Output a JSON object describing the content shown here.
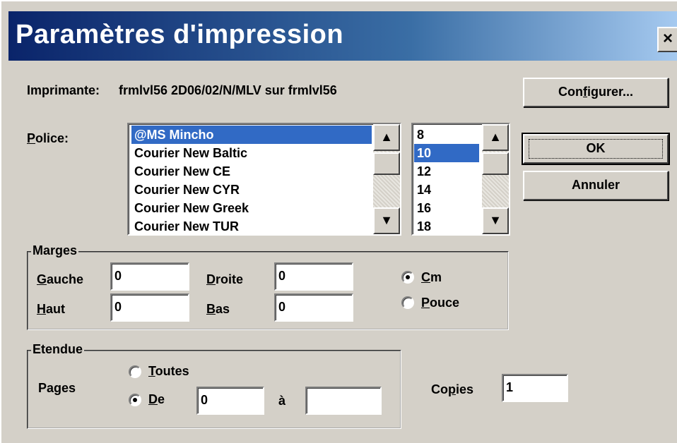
{
  "dialog": {
    "title": "Paramètres d'impression",
    "close_glyph": "×"
  },
  "printer": {
    "label": "Imprimante:",
    "value": "frmlvl56 2D06/02/N/MLV sur frmlvl56"
  },
  "buttons": {
    "configure": {
      "pre": "Con",
      "u": "f",
      "post": "igurer..."
    },
    "ok": "OK",
    "cancel": "Annuler"
  },
  "font": {
    "label_u": "P",
    "label_rest": "olice:",
    "items": [
      "@MS Mincho",
      "Courier New Baltic",
      "Courier New CE",
      "Courier New CYR",
      "Courier New Greek",
      "Courier New TUR"
    ],
    "selected": "@MS Mincho"
  },
  "size": {
    "items": [
      "8",
      "10",
      "12",
      "14",
      "16",
      "18"
    ],
    "selected": "10"
  },
  "scroll_icons": {
    "up": "scroll-up-arrow-icon",
    "down": "scroll-down-arrow-icon"
  },
  "margins": {
    "group_label": "Marges",
    "left": {
      "u": "G",
      "rest": "auche",
      "value": "0"
    },
    "right": {
      "u": "D",
      "rest": "roite",
      "value": "0"
    },
    "top": {
      "u": "H",
      "rest": "aut",
      "value": "0"
    },
    "bottom": {
      "u": "B",
      "rest": "as",
      "value": "0"
    },
    "unit_cm": {
      "u": "C",
      "rest": "m",
      "checked": true
    },
    "unit_inch": {
      "u": "P",
      "rest": "ouce",
      "checked": false
    }
  },
  "range": {
    "group_label": "Etendue",
    "pages_label": "Pages",
    "all": {
      "u": "T",
      "rest": "outes",
      "checked": false
    },
    "from": {
      "u": "D",
      "rest": "e",
      "checked": true,
      "value": "0"
    },
    "to_label": "à",
    "to_value": ""
  },
  "copies": {
    "pre": "Co",
    "u": "p",
    "post": "ies",
    "value": "1"
  }
}
